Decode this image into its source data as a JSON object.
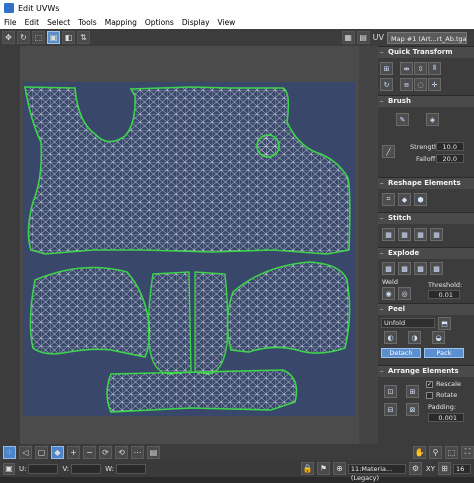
{
  "window": {
    "title": "Edit UVWs"
  },
  "menu": [
    "File",
    "Edit",
    "Select",
    "Tools",
    "Mapping",
    "Options",
    "Display",
    "View"
  ],
  "toolbar": {
    "uv_label": "UV",
    "map_select": "Map #1 (Art...rt_Ab.tga)"
  },
  "panel": {
    "quick_transform": "Quick Transform",
    "brush": "Brush",
    "strength_label": "Strength:",
    "strength_value": "10.0",
    "falloff_label": "Falloff:",
    "falloff_value": "20.0",
    "reshape": "Reshape Elements",
    "stitch": "Stitch",
    "explode": "Explode",
    "weld_label": "Weld",
    "threshold_label": "Threshold:",
    "threshold_value": "0.01",
    "peel": "Peel",
    "unfold_option": "Unfold",
    "detach_label": "Detach",
    "pack_label": "Pack",
    "arrange": "Arrange Elements",
    "rescale_label": "Rescale",
    "rotate_label": "Rotate",
    "padding_label": "Padding:",
    "padding_value": "0.001"
  },
  "status": {
    "u_label": "U:",
    "v_label": "V:",
    "w_label": "W:",
    "material": "11:Materia...(Legacy)",
    "xy_label": "XY",
    "grid_value": "16"
  },
  "colors": {
    "uv_background": "#38476a",
    "mesh_wire": "#ffffff",
    "seam": "#3dd34a",
    "accent": "#5b8fd0"
  }
}
